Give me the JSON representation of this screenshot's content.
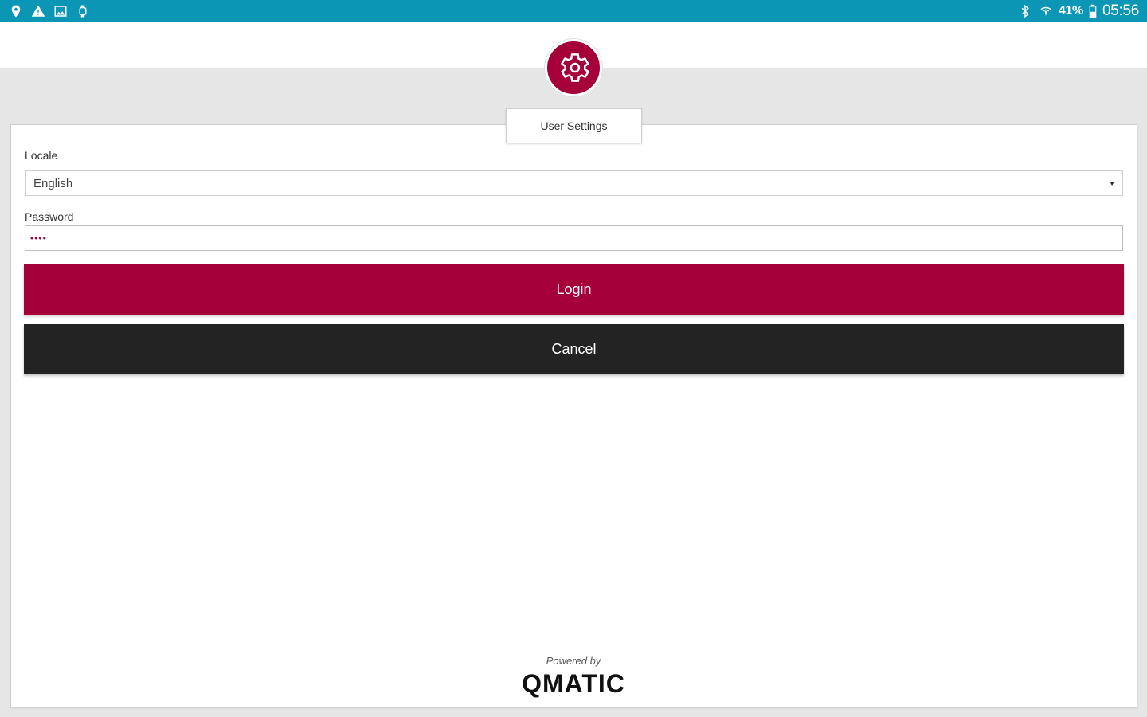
{
  "status_bar": {
    "left_icons": [
      "location-icon",
      "warning-icon",
      "image-icon",
      "watch-icon"
    ],
    "right_icons": [
      "bluetooth-icon",
      "wifi-icon",
      "battery-icon"
    ],
    "battery_percent": "41%",
    "time": "05:56",
    "color": "#0a96b4"
  },
  "dialog": {
    "title": "User Settings",
    "icon": "gear-icon",
    "accent_color": "#a6003a"
  },
  "form": {
    "locale_label": "Locale",
    "locale_value": "English",
    "password_label": "Password",
    "password_value": "••••"
  },
  "buttons": {
    "login_label": "Login",
    "cancel_label": "Cancel"
  },
  "footer": {
    "powered_by": "Powered by",
    "brand": "QMATIC"
  }
}
